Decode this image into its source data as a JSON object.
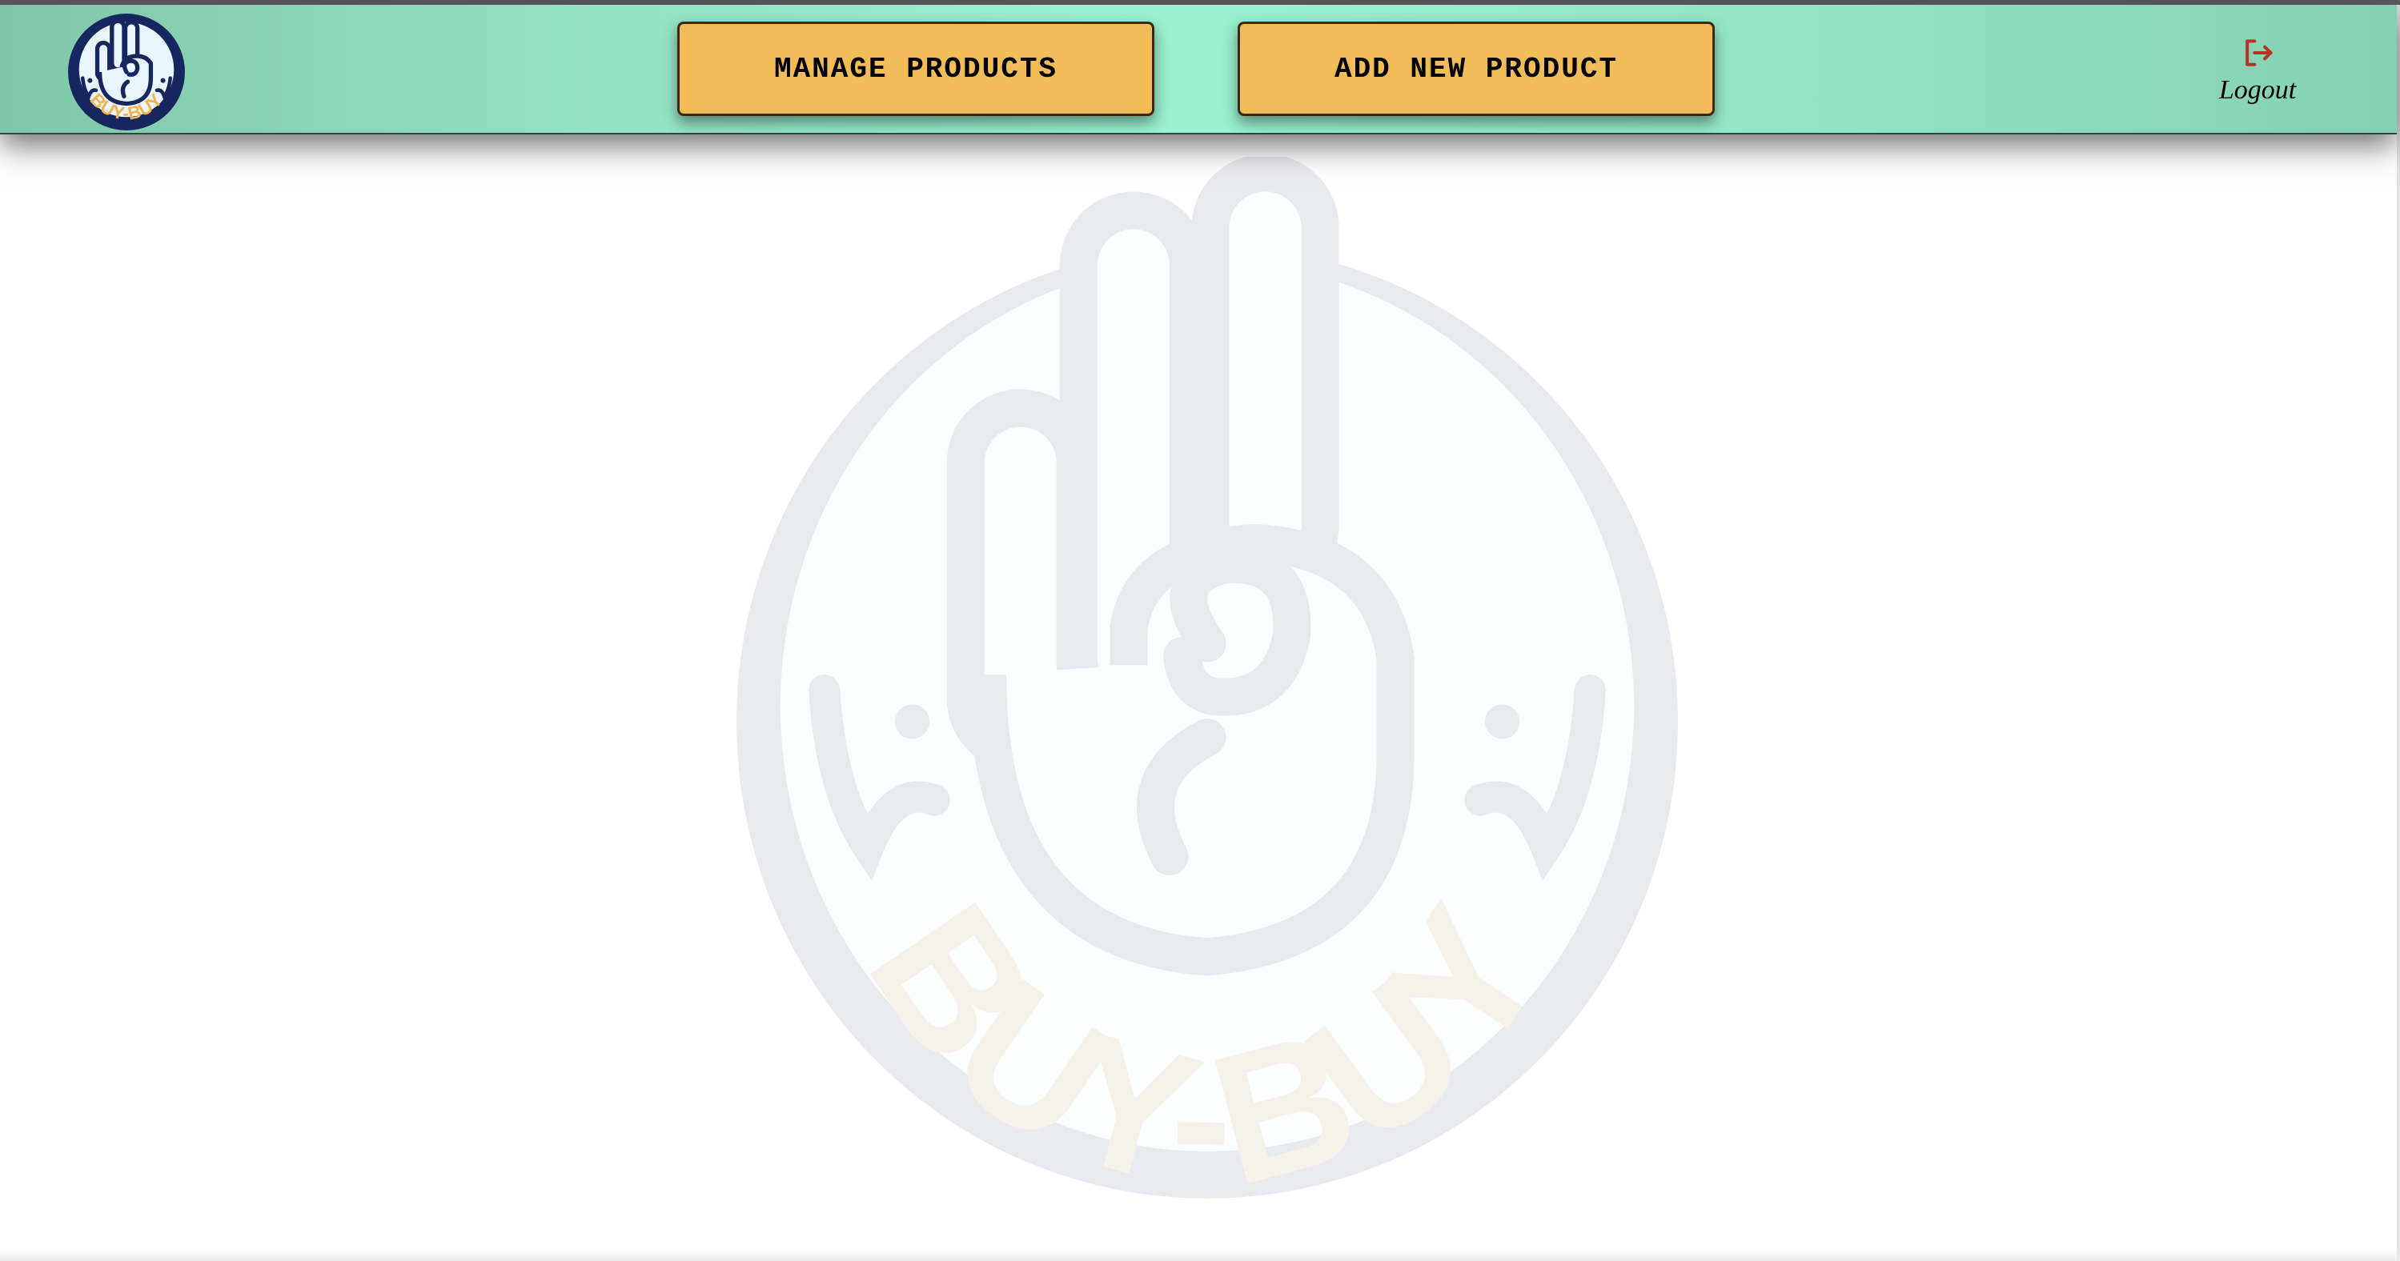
{
  "brand": {
    "logo_text": "BUY-BUY",
    "colors": {
      "navy": "#16265e",
      "light_blue": "#e8f4ff",
      "gold": "#f2b54b"
    }
  },
  "navbar": {
    "buttons": [
      {
        "label": "MANAGE PRODUCTS"
      },
      {
        "label": "ADD NEW PRODUCT"
      }
    ],
    "logout": {
      "label": "Logout",
      "icon": "logout-icon",
      "icon_color": "#b83228"
    },
    "colors": {
      "gradient_center": "#9af2d0",
      "button_fill": "#f2bd58"
    }
  },
  "main": {
    "watermark_text": "BUY-BUY"
  }
}
